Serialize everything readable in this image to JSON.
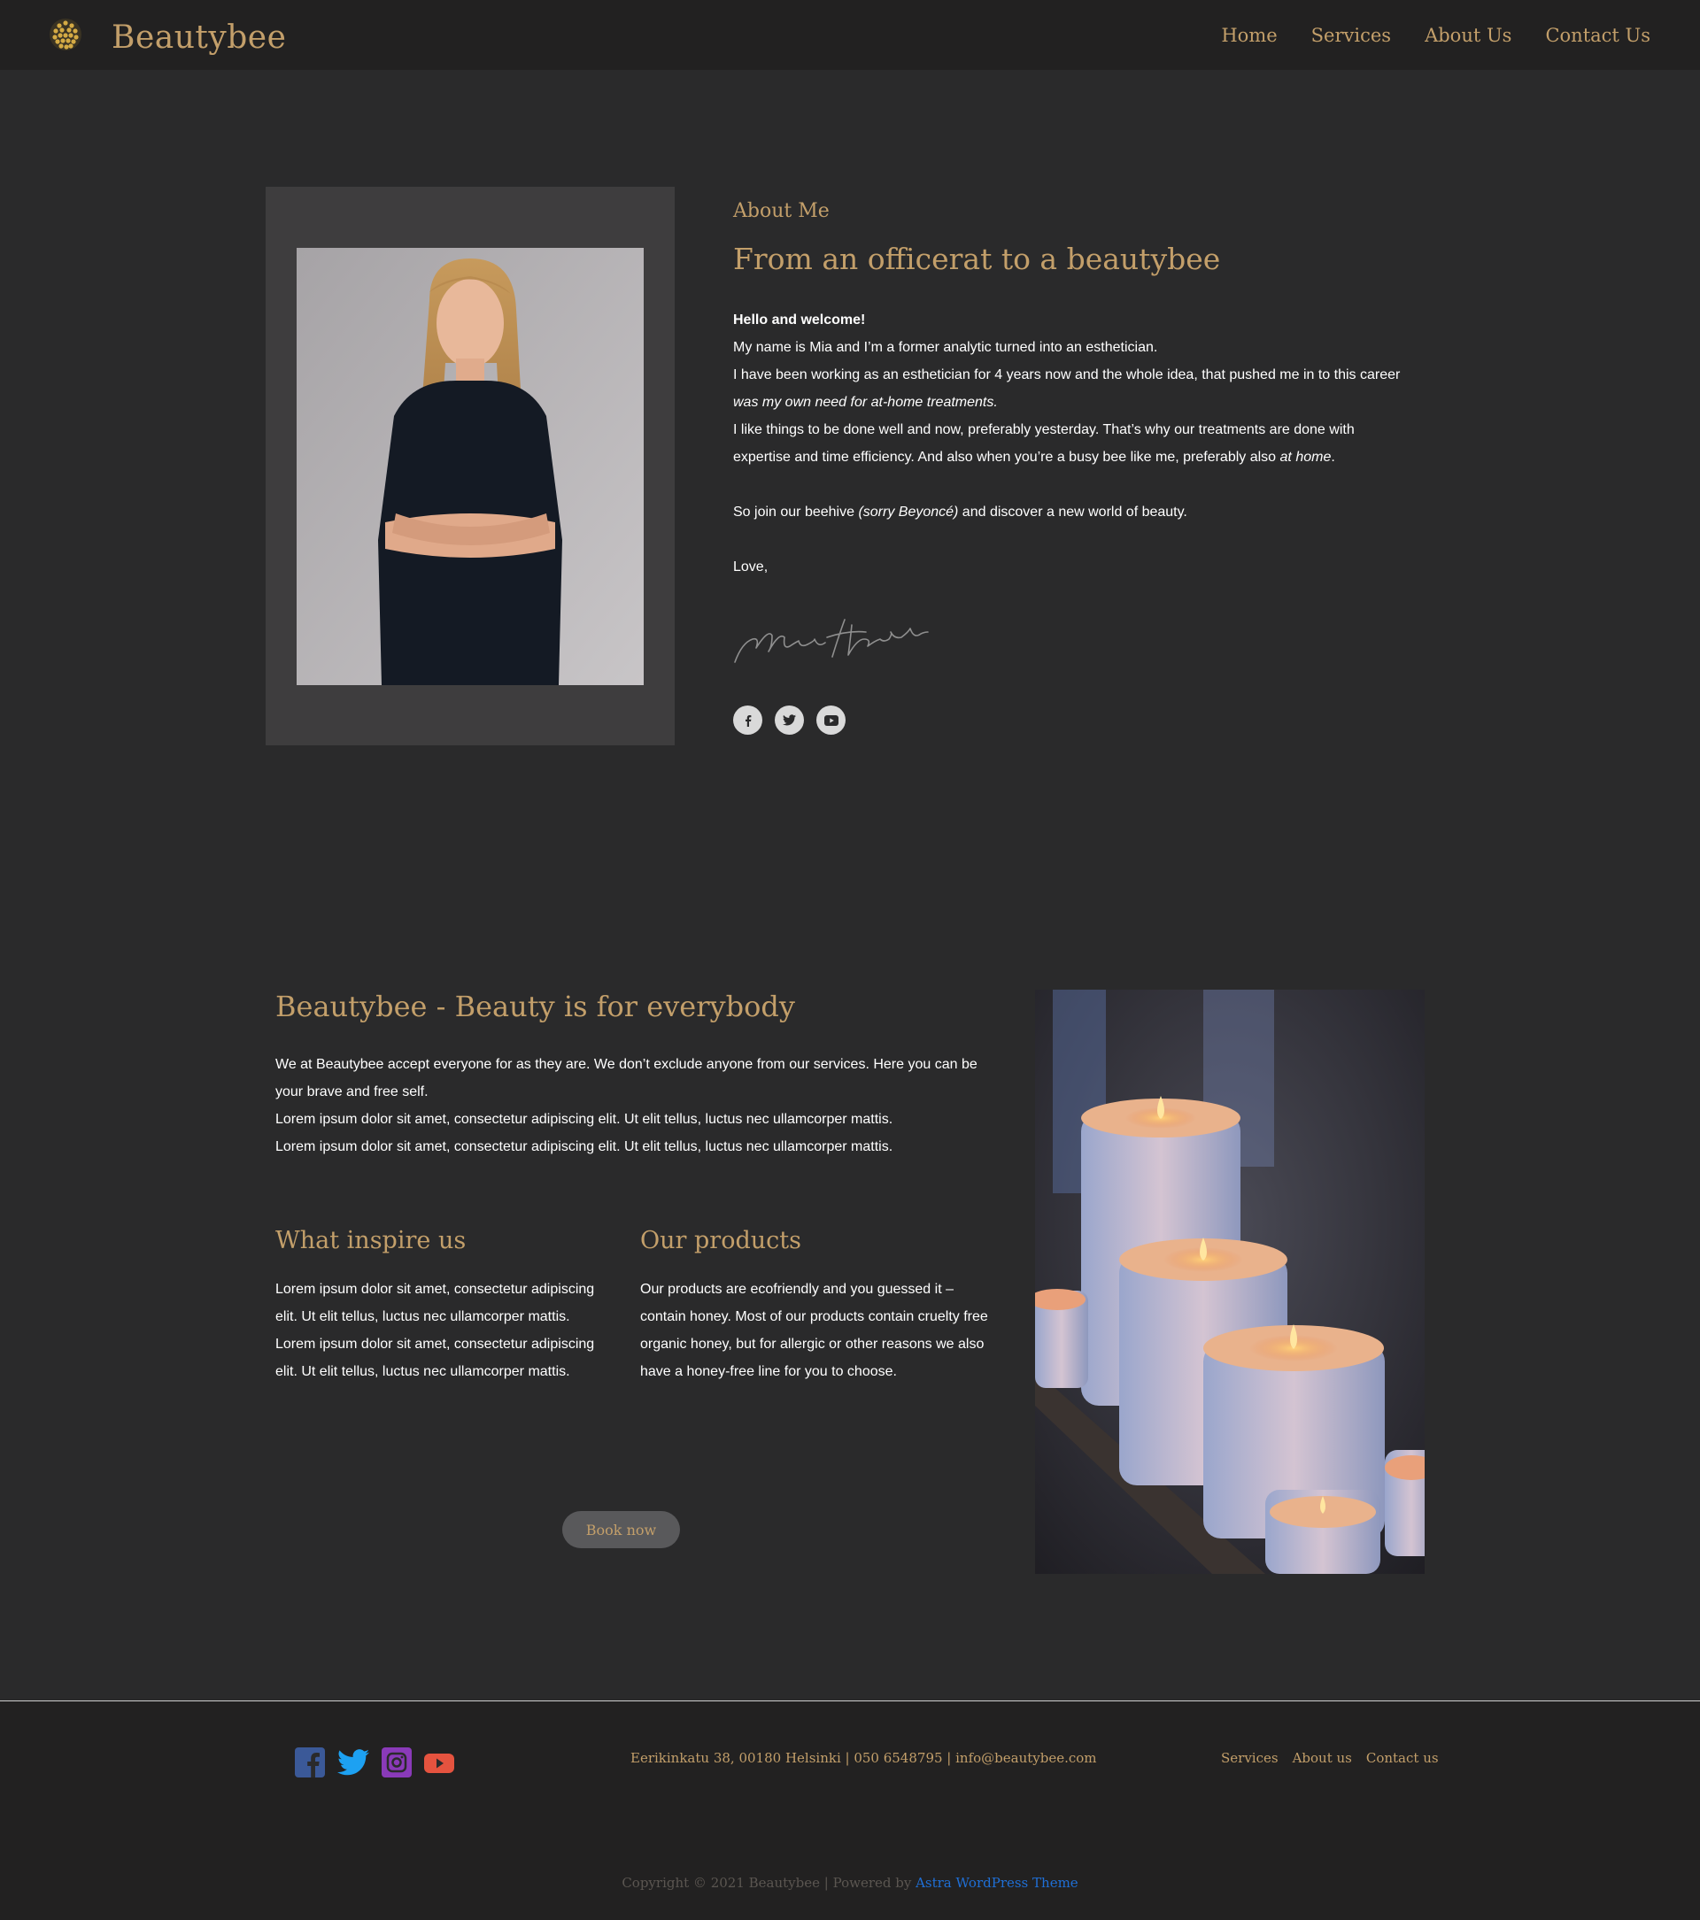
{
  "header": {
    "brand": "Beautybee",
    "nav": [
      "Home",
      "Services",
      "About Us",
      "Contact Us"
    ]
  },
  "about": {
    "eyebrow": "About Me",
    "title": "From an officerat to a beautybee",
    "greeting": "Hello and welcome!",
    "line1": "My name is Mia and I’m a former analytic turned into an esthetician.",
    "line2": "I have been working as an esthetician for 4 years now and the whole idea, that pushed me in to this career",
    "line3_italic": "was my own need for at-home treatments.",
    "line4": "I like things to be done well and now, preferably yesterday. That’s why our treatments are done with",
    "line5_pre": "expertise and time efficiency. And also when you’re a busy bee like me, preferably also ",
    "line5_italic": "at home",
    "line5_post": ".",
    "line6_pre": "So join our beehive ",
    "line6_italic": "(sorry Beyoncé)",
    "line6_post": " and discover a new world of beauty.",
    "signoff": "Love,",
    "signature": "Mia Hoelchin",
    "social": [
      "facebook-icon",
      "twitter-icon",
      "youtube-icon"
    ]
  },
  "beauty": {
    "title": "Beautybee - Beauty is for everybody",
    "p1": "We at Beautybee accept everyone for as they are. We don’t exclude anyone from our services. Here you can be your brave and free self.",
    "p2": "Lorem ipsum dolor sit amet, consectetur adipiscing elit. Ut elit tellus, luctus nec ullamcorper mattis.",
    "p3": "Lorem ipsum dolor sit amet, consectetur adipiscing elit. Ut elit tellus, luctus nec ullamcorper mattis.",
    "inspire_title": "What inspire us",
    "inspire_p1": "Lorem ipsum dolor sit amet, consectetur adipiscing elit. Ut elit tellus, luctus nec ullamcorper mattis.",
    "inspire_p2": "Lorem ipsum dolor sit amet, consectetur adipiscing elit. Ut elit tellus, luctus nec ullamcorper mattis.",
    "products_title": "Our products",
    "products_p": "Our products are ecofriendly and you guessed it – contain honey. Most of our products contain cruelty free organic honey, but for allergic or other reasons we also have a honey-free line for you to choose.",
    "button": "Book now"
  },
  "footer": {
    "social": [
      "facebook-icon",
      "twitter-icon",
      "instagram-icon",
      "youtube-icon"
    ],
    "address": "Eerikinkatu 38, 00180 Helsinki | 050 6548795 | info@beautybee.com",
    "links": [
      "Services",
      "About us",
      "Contact us"
    ],
    "copyright": "Copyright © 2021 Beautybee | Powered by ",
    "theme_link": "Astra WordPress Theme"
  },
  "colors": {
    "accent": "#c39f6a",
    "background": "#2a2a2b",
    "header": "#222121",
    "link": "#1f6fd6"
  }
}
